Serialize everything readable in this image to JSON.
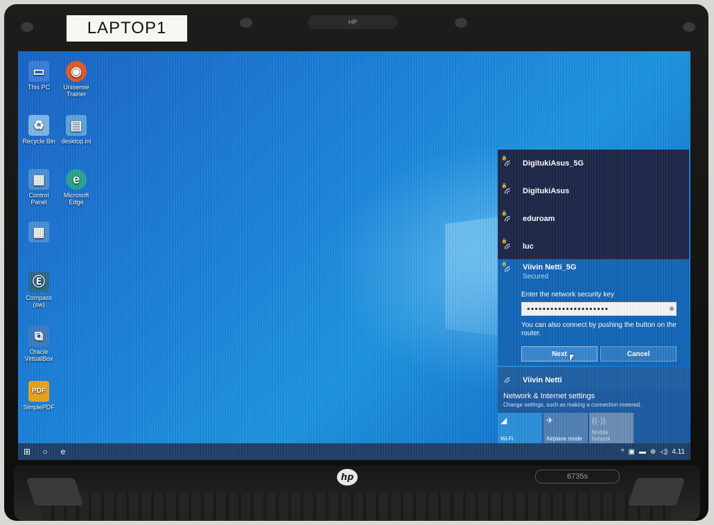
{
  "photo": {
    "laptop_label": "LAPTOP1",
    "brand_logo": "hp",
    "model_badge": "6735s",
    "webcam_text": "HP"
  },
  "desktop": {
    "icons": [
      {
        "label": "This PC",
        "icon": "computer-icon",
        "color": "#3b7dd8"
      },
      {
        "label": "Unisense Trainer",
        "icon": "unisense-icon",
        "color": "#e05a2b"
      },
      {
        "label": "Recycle Bin",
        "icon": "recycle-bin-icon",
        "color": "#7eb6e6"
      },
      {
        "label": "desktop.ini",
        "icon": "file-icon",
        "color": "#5ca3dd"
      },
      {
        "label": "Control Panel",
        "icon": "control-panel-icon",
        "color": "#4a8fd4"
      },
      {
        "label": "Microsoft Edge",
        "icon": "edge-icon",
        "color": "#2aa38f"
      },
      {
        "label": "",
        "icon": "control-panel-icon",
        "color": "#4a8fd4"
      },
      {
        "label": "Compass (sw)",
        "icon": "compass-icon",
        "color": "#2a6a8a"
      },
      {
        "label": "Oracle VirtualBox",
        "icon": "virtualbox-icon",
        "color": "#3d7cc0"
      },
      {
        "label": "SimplePDF",
        "icon": "pdf-icon",
        "color": "#e8a21a"
      }
    ]
  },
  "wifi_flyout": {
    "networks": [
      {
        "name": "DigitukiAsus_5G",
        "icon": "wifi-secured-icon"
      },
      {
        "name": "DigitukiAsus",
        "icon": "wifi-secured-icon"
      },
      {
        "name": "eduroam",
        "icon": "wifi-secured-icon"
      },
      {
        "name": "luc",
        "icon": "wifi-secured-icon"
      }
    ],
    "selected": {
      "name": "Viivin Netti_5G",
      "status": "Secured",
      "prompt": "Enter the network security key",
      "key_value": "•••••••••••••••••••••",
      "hint": "You can also connect by pushing the button on the router.",
      "next_label": "Next",
      "cancel_label": "Cancel"
    },
    "other_network": {
      "name": "Viivin Netti"
    },
    "settings": {
      "title": "Network & Internet settings",
      "description": "Change settings, such as making a connection metered."
    },
    "quick_actions": [
      {
        "label": "Wi-Fi",
        "icon": "wifi-icon",
        "active": true
      },
      {
        "label": "Airplane mode",
        "icon": "airplane-icon",
        "active": false
      },
      {
        "label": "Mobile hotspot",
        "icon": "hotspot-icon",
        "active": false
      }
    ]
  },
  "taskbar": {
    "items": [
      {
        "icon": "windows-start-icon",
        "glyph": "⊞"
      },
      {
        "icon": "search-icon",
        "glyph": "○"
      },
      {
        "icon": "edge-icon",
        "glyph": "e"
      }
    ],
    "tray_time": "4.11",
    "tray_icons": [
      "chevron-up-icon",
      "network-icon",
      "battery-icon",
      "globe-icon",
      "volume-icon"
    ]
  },
  "colors": {
    "flyout_bg": "#1e2748",
    "selected_bg": "#1266b6",
    "accent": "#2f7ac3",
    "taskbar": "#1e3f67"
  }
}
